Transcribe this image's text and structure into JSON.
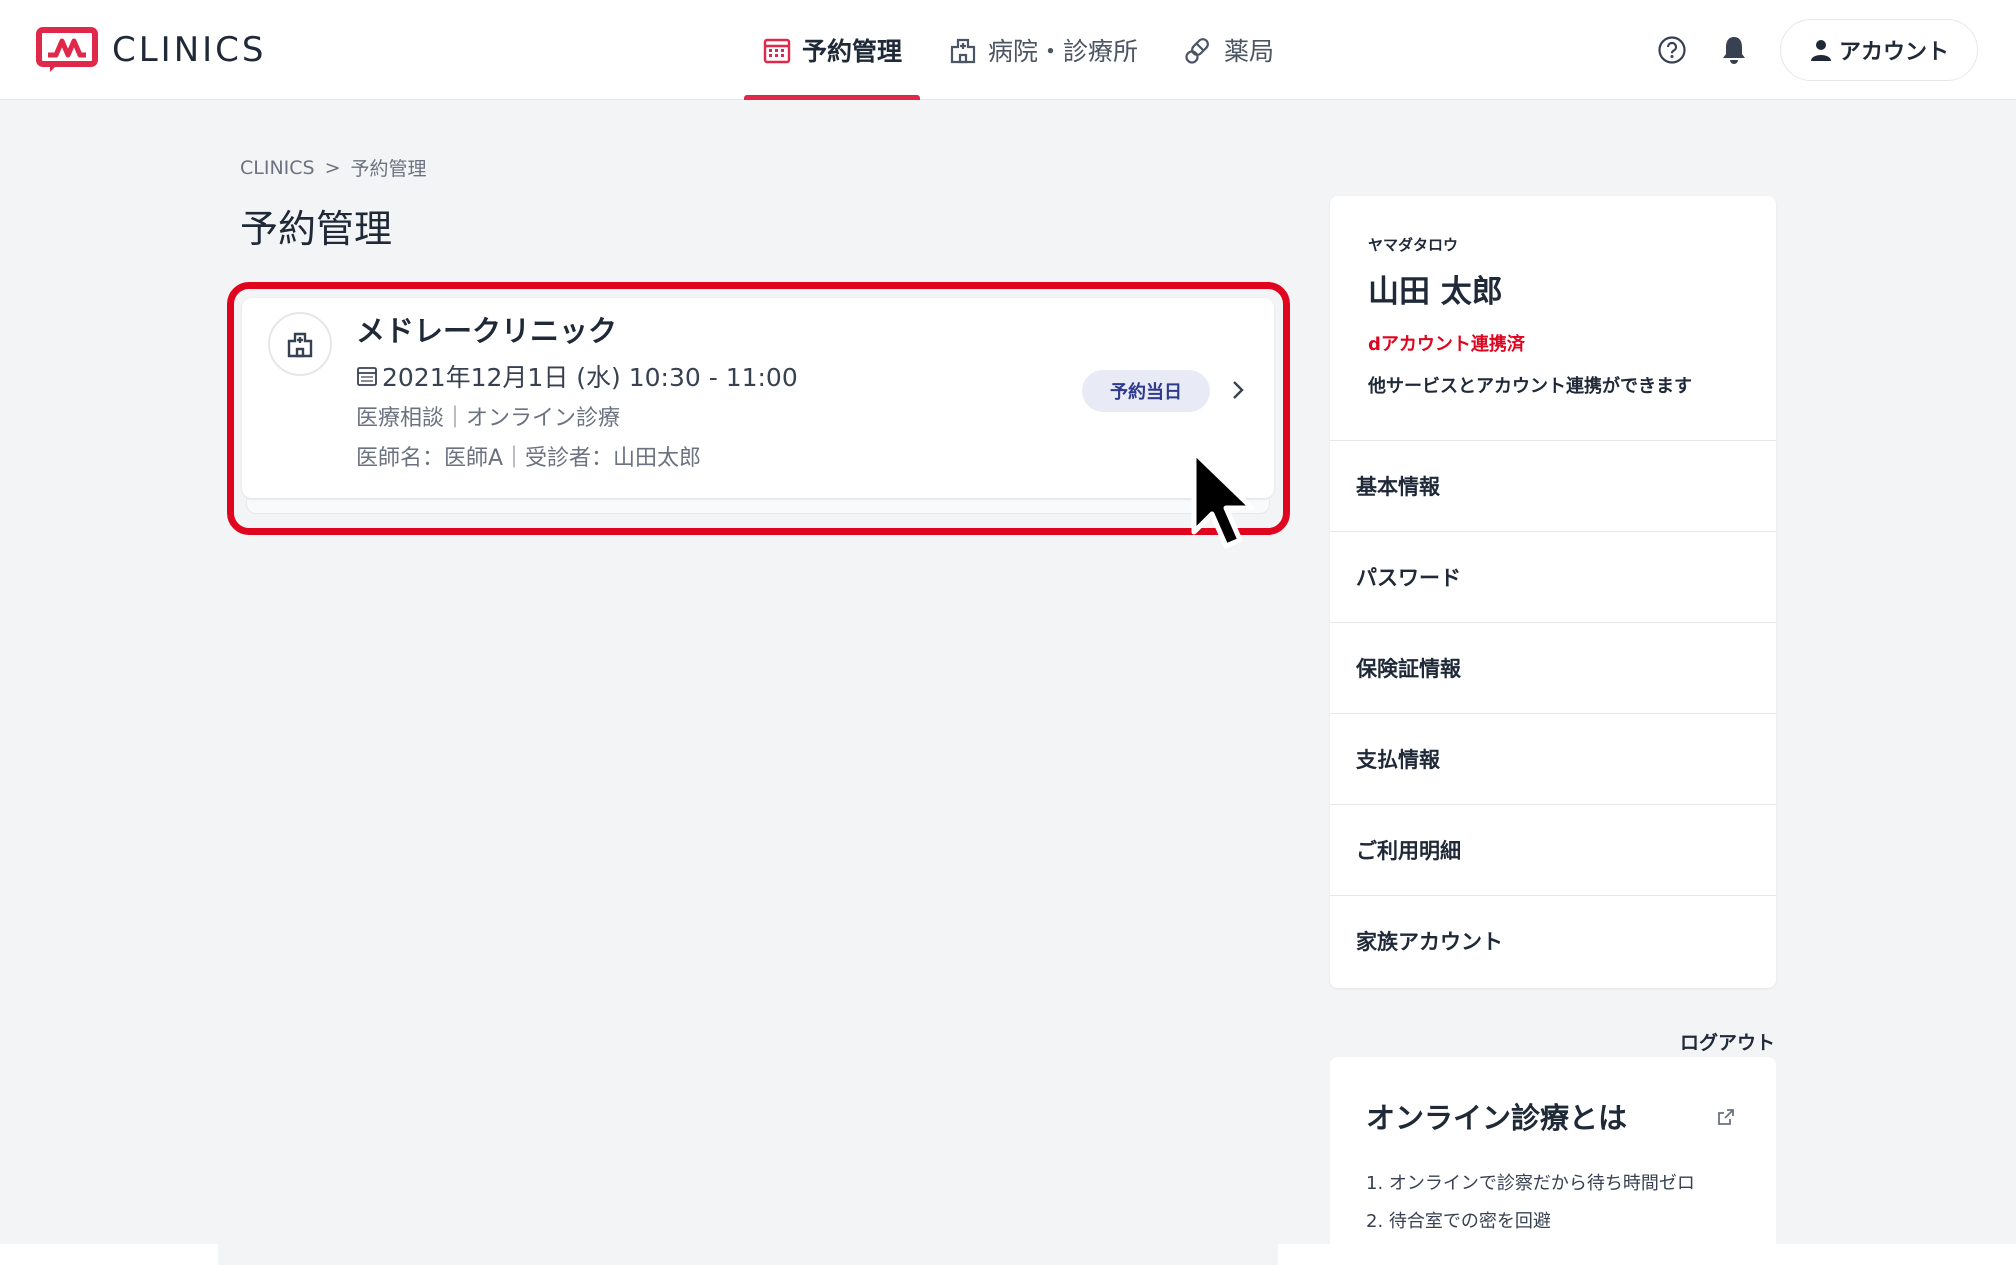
{
  "header": {
    "logo_text": "CLINICS",
    "nav": [
      {
        "label": "予約管理",
        "icon": "calendar-icon",
        "active": true
      },
      {
        "label": "病院・診療所",
        "icon": "hospital-icon",
        "active": false
      },
      {
        "label": "薬局",
        "icon": "pill-icon",
        "active": false
      }
    ],
    "account_label": "アカウント"
  },
  "breadcrumb": {
    "root": "CLINICS",
    "separator": ">",
    "current": "予約管理"
  },
  "page_title": "予約管理",
  "appointment": {
    "clinic_name": "メドレークリニック",
    "datetime": "2021年12月1日 (水) 10:30 - 11:00",
    "type": "医療相談｜オンライン診療",
    "doctor": "医師名：医師A｜受診者：山田太郎",
    "status": "予約当日"
  },
  "profile": {
    "kana": "ヤマダタロウ",
    "name": "山田 太郎",
    "d_account": "dアカウント連携済",
    "d_desc": "他サービスとアカウント連携ができます",
    "menu": [
      {
        "label": "基本情報"
      },
      {
        "label": "パスワード"
      },
      {
        "label": "保険証情報"
      },
      {
        "label": "支払情報"
      },
      {
        "label": "ご利用明細"
      },
      {
        "label": "家族アカウント"
      }
    ],
    "logout": "ログアウト"
  },
  "info": {
    "title": "オンライン診療とは",
    "items": [
      "1. オンラインで診察だから待ち時間ゼロ",
      "2. 待合室での密を回避"
    ]
  },
  "colors": {
    "accent": "#e0284a",
    "highlight": "#e0051f",
    "badge_bg": "#e8eaf6",
    "badge_text": "#2e3a8c"
  }
}
